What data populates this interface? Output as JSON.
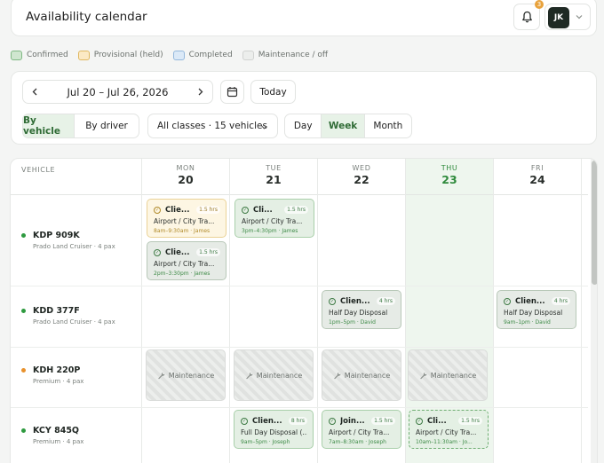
{
  "header": {
    "title": "Availability calendar",
    "notifications_count": "3",
    "user_initials": "JK"
  },
  "legend": [
    {
      "label": "Confirmed",
      "color": "#cfe6cf",
      "border": "#7fb883"
    },
    {
      "label": "Provisional (held)",
      "color": "#fbe9c4",
      "border": "#e0b860"
    },
    {
      "label": "Completed",
      "color": "#dbe9f7",
      "border": "#94b8dc"
    },
    {
      "label": "Maintenance / off",
      "color": "#eceeec",
      "border": "#d0d2d0"
    }
  ],
  "toolbar": {
    "date_range": "Jul 20 – Jul 26, 2026",
    "today_label": "Today",
    "view_by": [
      "By vehicle",
      "By driver"
    ],
    "class_filter": "All classes · 15 vehicles",
    "period": [
      "Day",
      "Week",
      "Month"
    ]
  },
  "calendar": {
    "vehicle_header": "VEHICLE",
    "days": [
      {
        "dow": "MON",
        "date": "20"
      },
      {
        "dow": "TUE",
        "date": "21"
      },
      {
        "dow": "WED",
        "date": "22"
      },
      {
        "dow": "THU",
        "date": "23"
      },
      {
        "dow": "FRI",
        "date": "24"
      }
    ],
    "vehicles": [
      {
        "plate": "KDP 909K",
        "meta": "Prado Land Cruiser · 4 pax",
        "status_color": "#2e9a3f"
      },
      {
        "plate": "KDD 377F",
        "meta": "Prado Land Cruiser · 4 pax",
        "status_color": "#2e9a3f"
      },
      {
        "plate": "KDH 220P",
        "meta": "Premium · 4 pax",
        "status_color": "#e8912c"
      },
      {
        "plate": "KCY 845Q",
        "meta": "Premium · 4 pax",
        "status_color": "#2e9a3f"
      }
    ],
    "bookings": [
      {
        "name": "Clie...",
        "duration": "1.5 hrs",
        "desc": "Airport / City Tra...",
        "time": "8am–9:30am · James"
      },
      {
        "name": "Clie...",
        "duration": "1.5 hrs",
        "desc": "Airport / City Tra...",
        "time": "2pm–3:30pm · James"
      },
      {
        "name": "Cli...",
        "duration": "1.5 hrs",
        "desc": "Airport / City Tra...",
        "time": "3pm–4:30pm · James"
      },
      {
        "name": "Clien...",
        "duration": "4 hrs",
        "desc": "Half Day Disposal",
        "time": "1pm–5pm · David"
      },
      {
        "name": "Clien...",
        "duration": "4 hrs",
        "desc": "Half Day Disposal",
        "time": "9am–1pm · David"
      },
      {
        "name": "Clien...",
        "duration": "8 hrs",
        "desc": "Full Day Disposal (...",
        "time": "9am–5pm · Joseph"
      },
      {
        "name": "Join...",
        "duration": "1.5 hrs",
        "desc": "Airport / City Tra...",
        "time": "7am–8:30am · Joseph"
      },
      {
        "name": "Cli...",
        "duration": "1.5 hrs",
        "desc": "Airport / City Tra...",
        "time": "10am–11:30am · Jo..."
      }
    ],
    "maintenance_label": "Maintenance"
  }
}
